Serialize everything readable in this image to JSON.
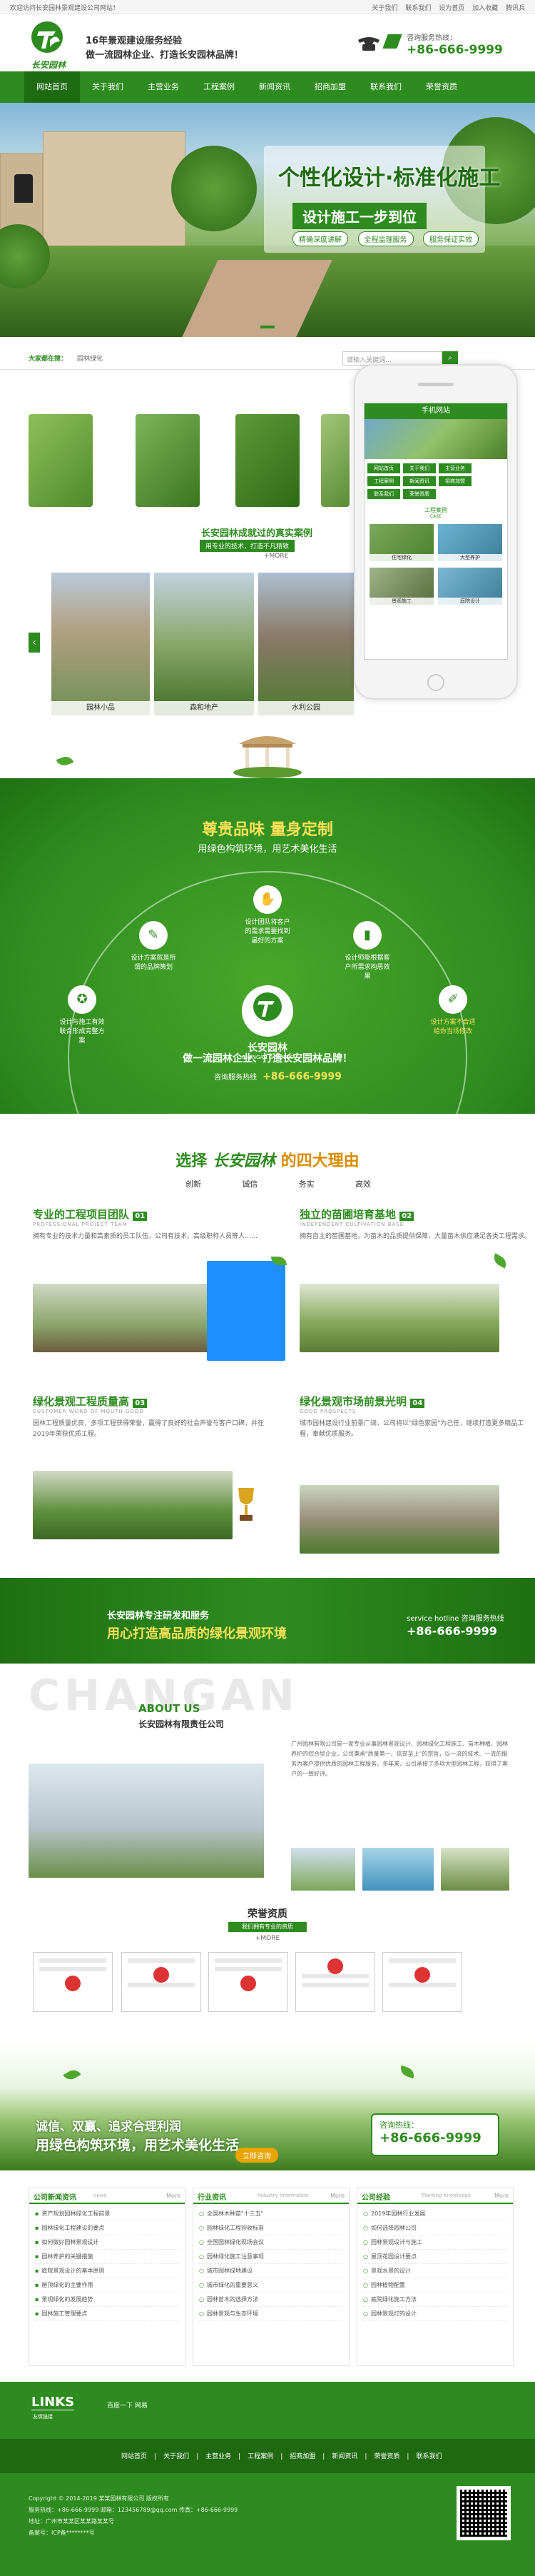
{
  "topbar": {
    "welcome": "欢迎访问长安园林景观建设公司网站！",
    "links": [
      "关于我们",
      "联系我们",
      "设为首页",
      "加入收藏",
      "腾讯兵"
    ]
  },
  "header": {
    "slogan1": "16年景观建设服务经验",
    "slogan2": "做一流园林企业、打造长安园林品牌！",
    "hotline_label": "咨询服务热线：",
    "hotline": "+86-666-9999",
    "logo_text": "长安园林"
  },
  "nav": [
    "网站首页",
    "关于我们",
    "主营业务",
    "工程案例",
    "新闻资讯",
    "招商加盟",
    "联系我们",
    "荣誉资质"
  ],
  "banner": {
    "title": "个性化设计·标准化施工",
    "subtitle": "设计施工一步到位",
    "pills": [
      "精确深度讲解",
      "全程监理服务",
      "服务保证实效"
    ]
  },
  "search": {
    "hot_label": "大家都在搜：",
    "hot_words": "园林绿化",
    "placeholder": "请输入关键词..."
  },
  "phone": {
    "header": "手机网站",
    "case_title": "工程案例",
    "case_en": "CASE",
    "nav": [
      "网站首页",
      "关于我们",
      "主营业务",
      "工程案例",
      "新闻资讯",
      "招商加盟",
      "联系我们",
      "荣誉资质"
    ],
    "cells": [
      "住宅绿化",
      "大型养护",
      "景观施工",
      "庭院设计"
    ]
  },
  "cases": {
    "title": "长安园林成就过的真实案例",
    "subtitle": "用专业的技术，打造不凡精致",
    "more": "+MORE",
    "items": [
      "园林小品",
      "森和地产",
      "水利公园"
    ]
  },
  "feature": {
    "title": "尊贵品味  量身定制",
    "subtitle": "用绿色构筑环境，用艺术美化生活",
    "nodes": [
      "设计方案就是所谓的品牌策划",
      "设计团队将客户的需求需要找到最好的方案",
      "设计师能根据客户所需求构思效果",
      "设计与施工有效联合形成完整方案",
      "设计方案不合适给你当场修改",
      "设计全面分析为你量身定制方案"
    ],
    "slogan": "做一流园林企业、打造长安园林品牌！",
    "hot_label": "咨询服务热线",
    "hotline": "+86-666-9999",
    "logo_text": "长安园林",
    "logo_en": "CHANGAN GARDENS"
  },
  "reasons": {
    "title_pre": "选择",
    "title_brand": "长安园林",
    "title_post": "的四大理由",
    "keywords": [
      "创新",
      "诚信",
      "务实",
      "高效"
    ],
    "blocks": [
      {
        "num": "01",
        "title": "专业的工程项目团队",
        "en": "PROFESSIONAL PROJECT TEAM",
        "text": "拥有专业的技术力量和高素质的员工队伍，公司有技术、高级职称人员等人……"
      },
      {
        "num": "02",
        "title": "独立的苗圃培育基地",
        "en": "INDEPENDENT CULTIVATION BASE",
        "text": "拥有自主的苗圃基地，为苗木的品质提供保障，大量苗木供应满足各类工程需求。"
      },
      {
        "num": "03",
        "title": "绿化景观工程质量高",
        "en": "CUSTOMER WORD OF MOUTH GOOD",
        "text": "园林工程质量优良，多项工程获得荣誉，赢得了良好的社会声誉与客户口碑，并在2019年荣获优质工程。"
      },
      {
        "num": "04",
        "title": "绿化景观市场前景光明",
        "en": "GOOD PROSPECTS",
        "text": "城市园林建设行业前景广阔，公司将以\"绿色家园\"为己任，继续打造更多精品工程，奉献优质服务。"
      }
    ]
  },
  "band": {
    "line1": "长安园林专注研发和服务",
    "line2": "用心打造高品质的绿化景观环境",
    "hot_label": "咨询服务热线",
    "hotline": "+86-666-9999",
    "en": "service hotline"
  },
  "about": {
    "bg_word": "CHANGAN",
    "title": "ABOUT US",
    "company": "长安园林有限责任公司",
    "text": "广州园林有限公司是一家专业从事园林景观设计、园林绿化工程施工、苗木种植、园林养护的综合型企业，公司秉承\"质量第一、信誉至上\"的宗旨，以一流的技术、一流的服务为客户提供优质的园林工程服务。多年来，公司承接了多项大型园林工程，获得了客户的一致好评。"
  },
  "honor": {
    "title": "荣誉资质",
    "subtitle": "我们拥有专业的资质",
    "more": "+MORE"
  },
  "field": {
    "line1": "诚信、双赢、追求合理利润",
    "line2": "用绿色构筑环境，用艺术美化生活",
    "button": "立即咨询",
    "hot_label": "咨询热线：",
    "hotline": "+86-666-9999"
  },
  "news": [
    {
      "title": "公司新闻资讯",
      "en": "news",
      "more": "More",
      "items": [
        "资产规划园林绿化工程前景",
        "园林绿化工程建设的要点",
        "如何做好园林景观设计",
        "园林养护的关键措施",
        "庭院景观设计的基本原则",
        "屋顶绿化的主要作用",
        "景观绿化的发展趋势",
        "园林施工管理要点"
      ]
    },
    {
      "title": "行业资讯",
      "en": "Industry Information",
      "more": "More",
      "items": [
        "全国林木种苗\"十三五\"",
        "园林绿化工程验收标准",
        "全国园林绿化现场会议",
        "园林绿化施工注意事项",
        "城市园林绿地建设",
        "城市绿化的重要意义",
        "园林苗木的选择方法",
        "园林景观与生态环境"
      ]
    },
    {
      "title": "公司经验",
      "en": "Planting Knowledge",
      "more": "More",
      "items": [
        "2019年园林行业发展",
        "如何选择园林公司",
        "园林景观设计与施工",
        "屋顶花园设计要点",
        "景观水景的设计",
        "园林植物配置",
        "庭院绿化施工方法",
        "园林景观灯的设计"
      ]
    }
  ],
  "links": {
    "title": "LINKS",
    "sub": "友情链接",
    "items": "百度一下   网易"
  },
  "footer_nav": [
    "网站首页",
    "关于我们",
    "主营业务",
    "工程案例",
    "招商加盟",
    "新闻资讯",
    "荣誉资质",
    "联系我们"
  ],
  "footer": [
    "Copyright © 2014-2019 某某园林有限公司 版权所有",
    "服务热线：+86-666-9999  邮箱：123456789@qq.com  传真：+86-666-9999",
    "地址：广州市某某区某某路某某号",
    "备案号：ICP备********号"
  ]
}
